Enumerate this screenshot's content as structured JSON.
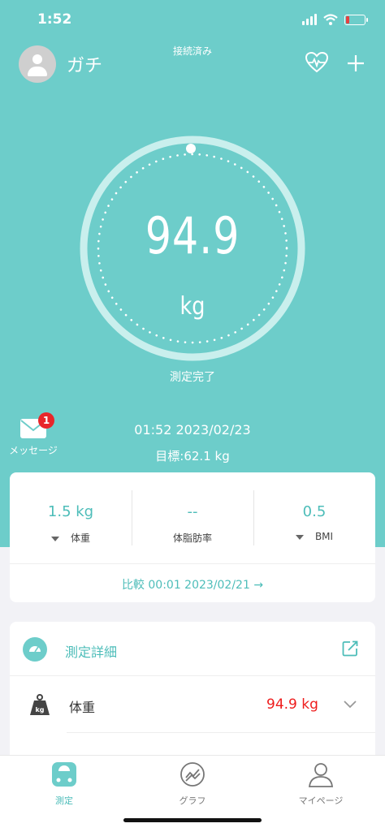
{
  "status_bar": {
    "time": "1:52"
  },
  "header": {
    "user_name": "ガチ",
    "connection_status": "接続済み"
  },
  "measurement": {
    "weight": "94.9",
    "unit": "kg",
    "status": "測定完了",
    "datetime": "01:52 2023/02/23",
    "goal": "目標:62.1 kg"
  },
  "messages": {
    "label": "メッセージ",
    "badge_count": "1"
  },
  "metrics": [
    {
      "value": "1.5 kg",
      "label": "体重",
      "trend": "down"
    },
    {
      "value": "--",
      "label": "体脂肪率",
      "trend": "none"
    },
    {
      "value": "0.5",
      "label": "BMI",
      "trend": "down"
    }
  ],
  "compare": {
    "text": "比較 00:01 2023/02/21 →"
  },
  "details": {
    "title": "測定詳細",
    "rows": [
      {
        "label": "体重",
        "value": "94.9 kg"
      }
    ]
  },
  "tabs": [
    {
      "label": "測定",
      "icon": "scale-icon",
      "active": true
    },
    {
      "label": "グラフ",
      "icon": "chart-icon",
      "active": false
    },
    {
      "label": "マイページ",
      "icon": "profile-icon",
      "active": false
    }
  ],
  "colors": {
    "accent": "#6dcdca",
    "accent_text": "#4dbdb9",
    "alert": "#ee1c1c",
    "badge": "#e8262a"
  }
}
